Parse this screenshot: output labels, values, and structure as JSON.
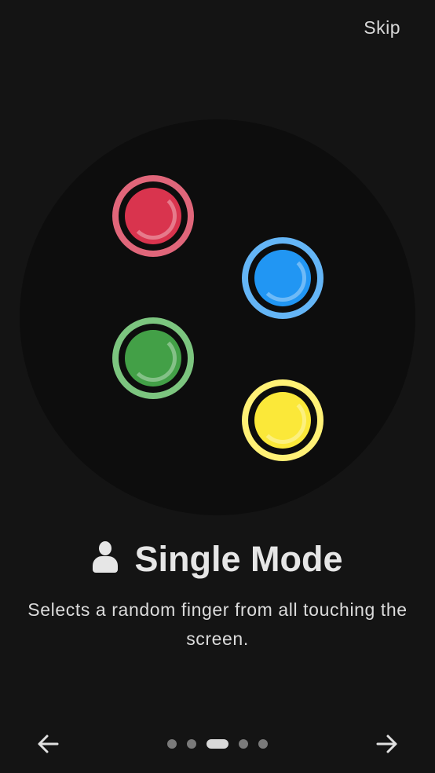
{
  "header": {
    "skip_label": "Skip"
  },
  "illustration": {
    "fingers": [
      {
        "name": "red",
        "color": "#d9344e",
        "ring_color": "#e0667a"
      },
      {
        "name": "blue",
        "color": "#2196f3",
        "ring_color": "#64b5f6"
      },
      {
        "name": "green",
        "color": "#43a047",
        "ring_color": "#7cc57f"
      },
      {
        "name": "yellow",
        "color": "#fbe839",
        "ring_color": "#fff176"
      }
    ]
  },
  "mode": {
    "icon": "person-icon",
    "title": "Single Mode",
    "description": "Selects a random finger from all touching the screen."
  },
  "pager": {
    "total_pages": 5,
    "active_index": 2,
    "back_icon": "arrow-left-icon",
    "next_icon": "arrow-right-icon"
  },
  "colors": {
    "background": "#141414",
    "illustration_background": "#0d0d0d",
    "text": "#e6e6e6",
    "dot_inactive": "#7a7a7a",
    "dot_active": "#d8d8d8"
  }
}
